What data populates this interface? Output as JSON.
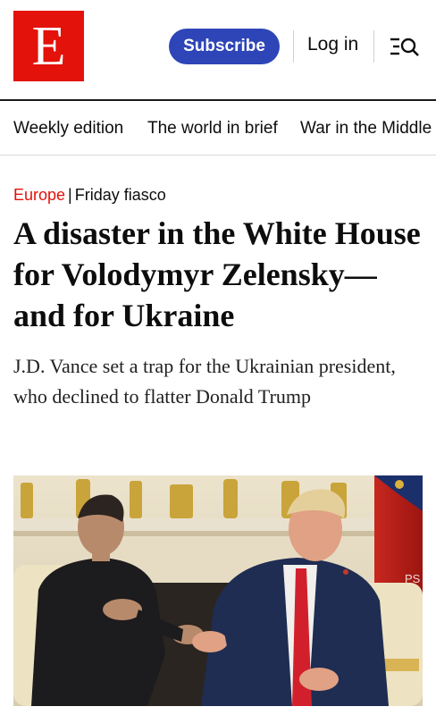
{
  "header": {
    "logo_letter": "E",
    "subscribe_label": "Subscribe",
    "login_label": "Log in",
    "menu_icon": "menu-search-icon"
  },
  "nav": {
    "items": [
      "Weekly edition",
      "The world in brief",
      "War in the Middle"
    ]
  },
  "article": {
    "section": "Europe",
    "separator": "|",
    "flytitle": "Friday fiasco",
    "headline": "A disaster in the White House for Volodymyr Zelensky—and for Ukraine",
    "standfirst": "J.D. Vance set a trap for the Ukrainian president, who declined to flatter Donald Trump",
    "image_text": "PS"
  },
  "colors": {
    "brand_red": "#e3120b",
    "subscribe_blue": "#2e45b8"
  }
}
